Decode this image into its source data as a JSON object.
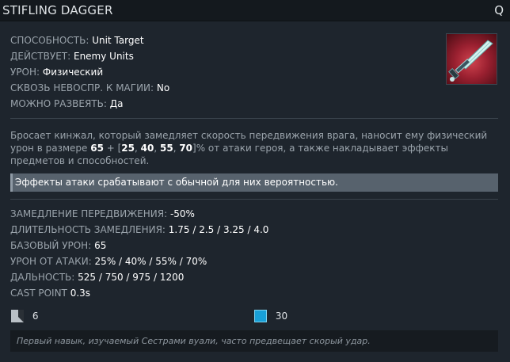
{
  "header": {
    "title": "STIFLING DAGGER",
    "hotkey": "Q"
  },
  "properties": [
    {
      "label": "СПОСОБНОСТЬ:",
      "value": "Unit Target"
    },
    {
      "label": "ДЕЙСТВУЕТ:",
      "value": "Enemy Units"
    },
    {
      "label": "УРОН:",
      "value": "Физический"
    },
    {
      "label": "СКВОЗЬ НЕВОСПР. К МАГИИ:",
      "value": "No"
    },
    {
      "label": "МОЖНО РАЗВЕЯТЬ:",
      "value": "Да"
    }
  ],
  "ability_icon": {
    "name": "stifling-dagger-icon"
  },
  "description": {
    "part1": "Бросает кинжал, который замедляет скорость передвижения врага, наносит ему физический урон в размере ",
    "base": "65",
    "plus": " + [",
    "v1": "25",
    "sep1": ", ",
    "v2": "40",
    "sep2": ", ",
    "v3": "55",
    "sep3": ", ",
    "v4": "70",
    "part2": "]% от атаки героя, а также накладывает эффекты предметов и способностей."
  },
  "note": "Эффекты атаки срабатывают с обычной для них вероятностью.",
  "stats": [
    {
      "label": "ЗАМЕДЛЕНИЕ ПЕРЕДВИЖЕНИЯ:",
      "value": "-50%"
    },
    {
      "label": "ДЛИТЕЛЬНОСТЬ ЗАМЕДЛЕНИЯ:",
      "value": "1.75 / 2.5 / 3.25 / 4.0"
    },
    {
      "label": "БАЗОВЫЙ УРОН:",
      "value": "65"
    },
    {
      "label": "УРОН ОТ АТАКИ:",
      "value": "25% / 40% / 55% / 70%"
    },
    {
      "label": "ДАЛЬНОСТЬ:",
      "value": "525 / 750 / 975 / 1200"
    },
    {
      "label": "CAST POINT",
      "value": "0.3s"
    }
  ],
  "cooldown": {
    "icon": "cooldown-icon",
    "value": "6"
  },
  "mana": {
    "icon": "mana-cost-icon",
    "value": "30",
    "color": "#18a0d8"
  },
  "lore": "Первый навык, изучаемый Сестрами вуали, часто предвещает скорый удар."
}
